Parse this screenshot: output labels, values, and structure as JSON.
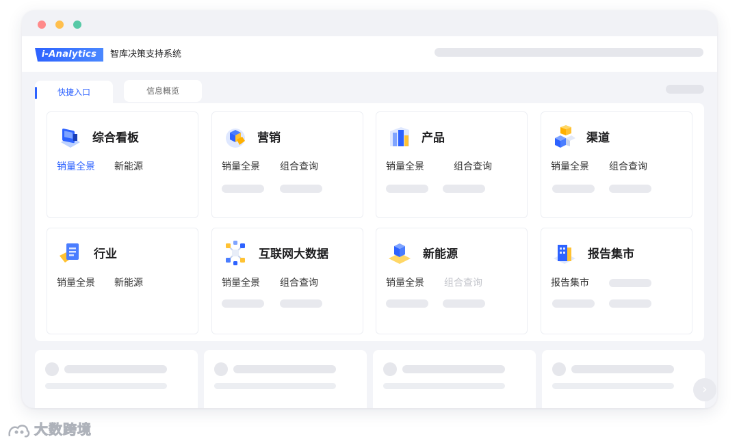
{
  "header": {
    "logo_text": "i-Analytics",
    "app_title": "智库决策支持系统"
  },
  "tabs": [
    {
      "label": "快捷入口",
      "active": true
    },
    {
      "label": "信息概览",
      "active": false
    }
  ],
  "cards": [
    {
      "title": "综合看板",
      "icon": "dashboard-monitor-icon",
      "links": [
        "销量全景",
        "新能源"
      ]
    },
    {
      "title": "营销",
      "icon": "marketing-cubes-icon",
      "links": [
        "销量全景",
        "组合查询"
      ]
    },
    {
      "title": "产品",
      "icon": "product-building-icon",
      "links": [
        "销量全景",
        "组合查询"
      ]
    },
    {
      "title": "渠道",
      "icon": "channel-cubes-icon",
      "links": [
        "销量全景",
        "组合查询"
      ]
    },
    {
      "title": "行业",
      "icon": "industry-document-icon",
      "links": [
        "销量全景",
        "新能源"
      ]
    },
    {
      "title": "互联网大数据",
      "icon": "internet-network-icon",
      "links": [
        "销量全景",
        "组合查询"
      ]
    },
    {
      "title": "新能源",
      "icon": "new-energy-cube-icon",
      "links": [
        "销量全景",
        "组合查询"
      ]
    },
    {
      "title": "报告集市",
      "icon": "report-building-icon",
      "links": [
        "报告集市"
      ]
    }
  ],
  "watermark": "大数跨境",
  "colors": {
    "accent": "#2d62ff",
    "skeleton": "#e8e9ee"
  }
}
